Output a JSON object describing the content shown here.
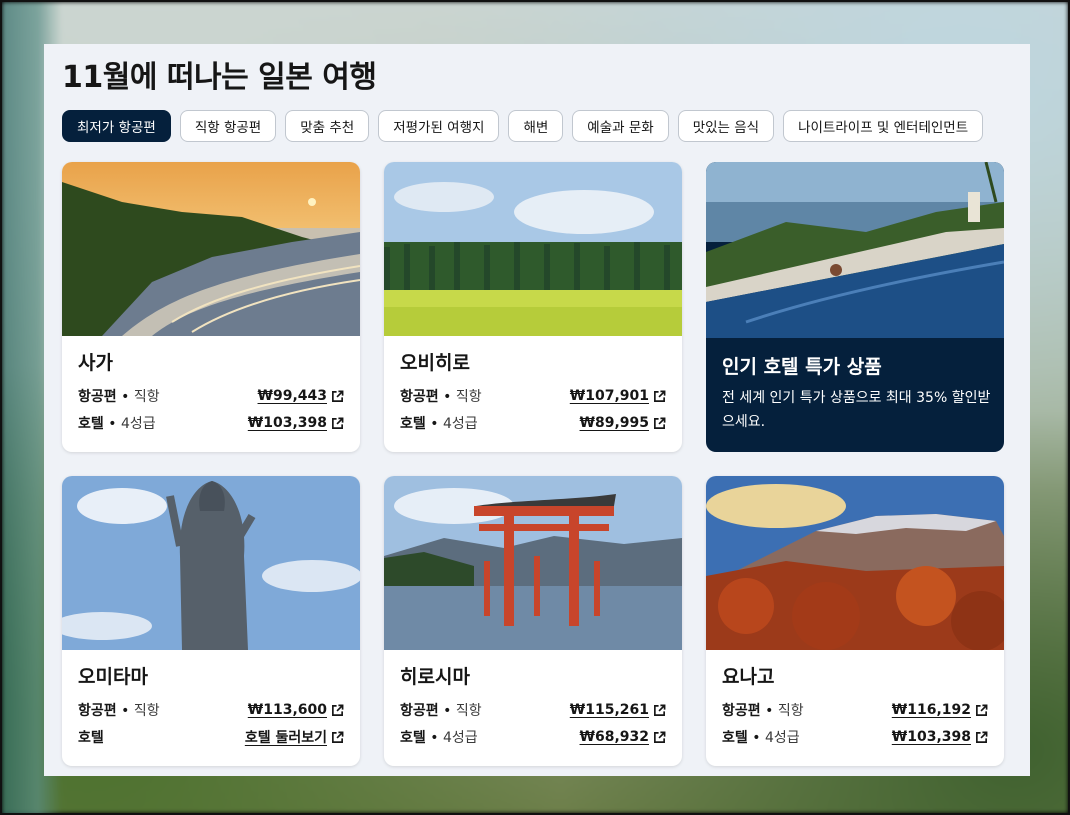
{
  "page_title": "11월에 떠나는 일본 여행",
  "filters": [
    {
      "label": "최저가 항공편",
      "active": true
    },
    {
      "label": "직항 항공편",
      "active": false
    },
    {
      "label": "맞춤 추천",
      "active": false
    },
    {
      "label": "저평가된 여행지",
      "active": false
    },
    {
      "label": "해변",
      "active": false
    },
    {
      "label": "예술과 문화",
      "active": false
    },
    {
      "label": "맛있는 음식",
      "active": false
    },
    {
      "label": "나이트라이프 및 엔터테인먼트",
      "active": false
    }
  ],
  "cards": [
    {
      "name": "사가",
      "flight_label": "항공편",
      "flight_sub": "직항",
      "flight_price": "₩99,443",
      "hotel_label": "호텔",
      "hotel_sub": "4성급",
      "hotel_price": "₩103,398"
    },
    {
      "name": "오비히로",
      "flight_label": "항공편",
      "flight_sub": "직항",
      "flight_price": "₩107,901",
      "hotel_label": "호텔",
      "hotel_sub": "4성급",
      "hotel_price": "₩89,995"
    },
    {
      "name": "오미타마",
      "flight_label": "항공편",
      "flight_sub": "직항",
      "flight_price": "₩113,600",
      "hotel_label": "호텔",
      "hotel_sub": "",
      "hotel_price": "호텔 둘러보기"
    },
    {
      "name": "히로시마",
      "flight_label": "항공편",
      "flight_sub": "직항",
      "flight_price": "₩115,261",
      "hotel_label": "호텔",
      "hotel_sub": "4성급",
      "hotel_price": "₩68,932"
    },
    {
      "name": "요나고",
      "flight_label": "항공편",
      "flight_sub": "직항",
      "flight_price": "₩116,192",
      "hotel_label": "호텔",
      "hotel_sub": "4성급",
      "hotel_price": "₩103,398"
    }
  ],
  "promo": {
    "title": "인기 호텔 특가 상품",
    "description": "전 세계 인기 특가 상품으로 최대 35% 할인받으세요."
  },
  "separator": " • ",
  "icons": {
    "external": "external-link-icon"
  },
  "colors": {
    "accent": "#05203c",
    "panel": "#eff2f7"
  }
}
